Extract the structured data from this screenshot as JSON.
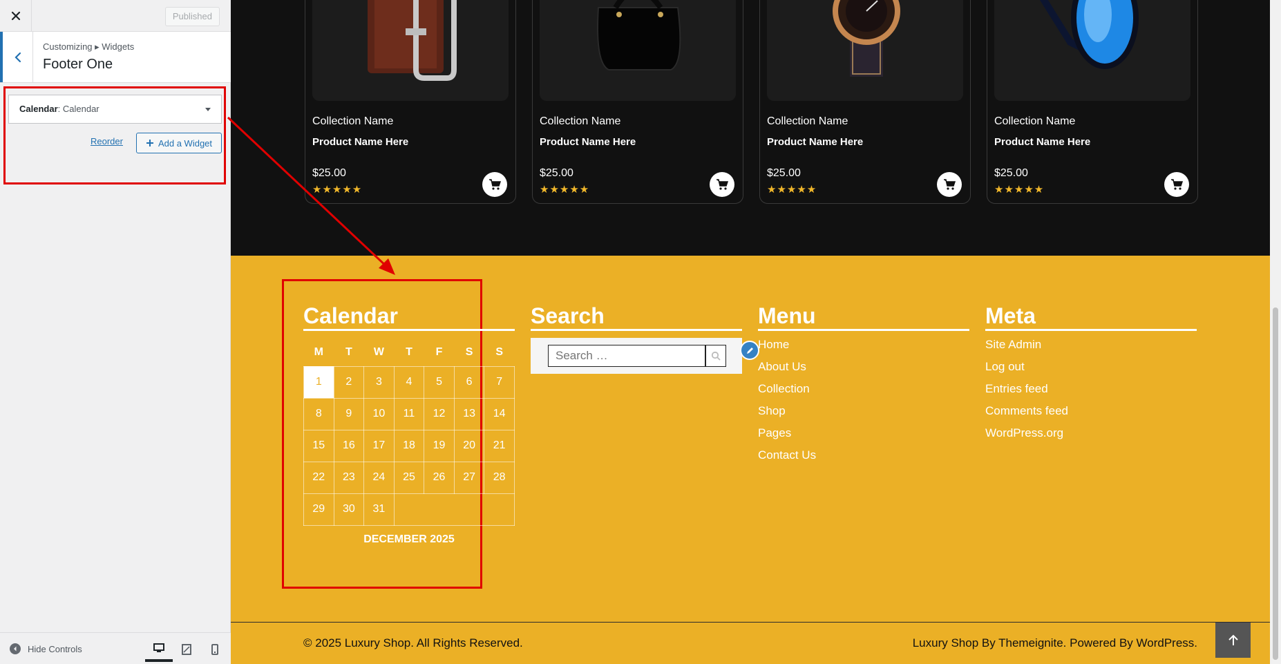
{
  "customizer": {
    "publish_label": "Published",
    "breadcrumb": "Customizing ▸ Widgets",
    "section_title": "Footer One",
    "widget": {
      "type": "Calendar",
      "sep": ": ",
      "title": "Calendar"
    },
    "reorder_label": "Reorder",
    "add_widget_label": "Add a Widget",
    "hide_controls_label": "Hide Controls",
    "devices": [
      "desktop",
      "tablet",
      "mobile"
    ],
    "accent": "#2271b1"
  },
  "products": [
    {
      "collection": "Collection Name",
      "name": "Product Name Here",
      "price": "$25.00",
      "rating": 5,
      "image": "belt-icon"
    },
    {
      "collection": "Collection Name",
      "name": "Product Name Here",
      "price": "$25.00",
      "rating": 5,
      "image": "handbag-icon"
    },
    {
      "collection": "Collection Name",
      "name": "Product Name Here",
      "price": "$25.00",
      "rating": 5,
      "image": "watch-icon"
    },
    {
      "collection": "Collection Name",
      "name": "Product Name Here",
      "price": "$25.00",
      "rating": 5,
      "image": "sunglasses-icon"
    }
  ],
  "footer": {
    "calendar": {
      "title": "Calendar",
      "days": [
        "M",
        "T",
        "W",
        "T",
        "F",
        "S",
        "S"
      ],
      "weeks": [
        [
          "1",
          "2",
          "3",
          "4",
          "5",
          "6",
          "7"
        ],
        [
          "8",
          "9",
          "10",
          "11",
          "12",
          "13",
          "14"
        ],
        [
          "15",
          "16",
          "17",
          "18",
          "19",
          "20",
          "21"
        ],
        [
          "22",
          "23",
          "24",
          "25",
          "26",
          "27",
          "28"
        ],
        [
          "29",
          "30",
          "31",
          "",
          "",
          "",
          ""
        ]
      ],
      "today": "1",
      "month_label": "DECEMBER 2025"
    },
    "search": {
      "title": "Search",
      "placeholder": "Search …"
    },
    "menu": {
      "title": "Menu",
      "items": [
        "Home",
        "About Us",
        "Collection",
        "Shop",
        "Pages",
        "Contact Us"
      ]
    },
    "meta": {
      "title": "Meta",
      "items": [
        "Site Admin",
        "Log out",
        "Entries feed",
        "Comments feed",
        "WordPress.org"
      ]
    },
    "copyright": "© 2025 Luxury Shop. All Rights Reserved.",
    "credits": "Luxury Shop By Themeignite. Powered By WordPress.",
    "colors": {
      "footer_bg": "#ebb026",
      "dark_bg": "#111111",
      "star": "#f2b82b",
      "highlight": "#e00000"
    }
  }
}
